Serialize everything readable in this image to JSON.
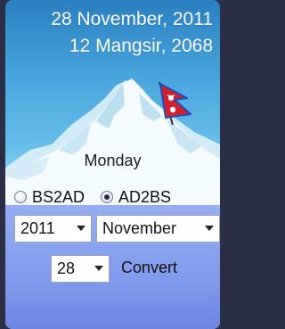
{
  "header": {
    "date_ad": "28 November, 2011",
    "date_bs": "12 Mangsir, 2068"
  },
  "main": {
    "weekday": "Monday",
    "mode": {
      "options": [
        {
          "label": "BS2AD",
          "checked": false
        },
        {
          "label": "AD2BS",
          "checked": true
        }
      ]
    },
    "year_select": {
      "value": "2011"
    },
    "month_select": {
      "value": "November"
    },
    "day_select": {
      "value": "28"
    },
    "convert_label": "Convert"
  },
  "icons": {
    "flag": "nepal-flag-icon",
    "mountain": "mountain-icon",
    "dropdown": "chevron-down-icon"
  },
  "colors": {
    "sky_top": "#2a7fbf",
    "panel": "#8ea7f0",
    "text_light": "#ffffff"
  }
}
